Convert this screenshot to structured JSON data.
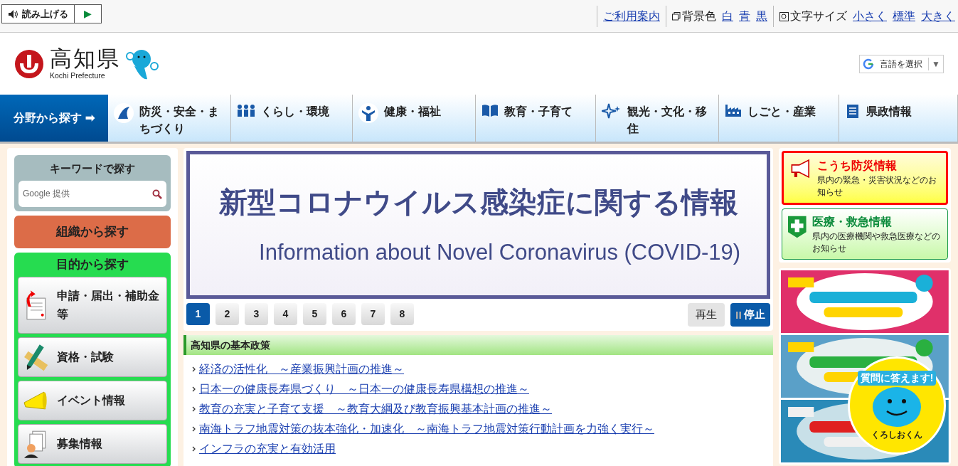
{
  "toolbar": {
    "read_aloud": "読み上げる",
    "play": "▶",
    "links": [
      {
        "kind": "link",
        "label": "ご利用案内"
      },
      {
        "kind": "label",
        "label": "背景色"
      },
      {
        "kind": "link",
        "label": "白"
      },
      {
        "kind": "link",
        "label": "青"
      },
      {
        "kind": "link",
        "label": "黒"
      },
      {
        "kind": "label",
        "label": "文字サイズ"
      },
      {
        "kind": "link",
        "label": "小さく"
      },
      {
        "kind": "link",
        "label": "標準"
      },
      {
        "kind": "link",
        "label": "大きく"
      }
    ]
  },
  "header": {
    "logo_title": "高知県",
    "logo_subtitle": "Kochi Prefecture",
    "language": "言語を選択",
    "language_caret": "▼"
  },
  "nav": {
    "lead": "分野から探す ➡",
    "items": [
      {
        "label": "防災・安全・まちづくり"
      },
      {
        "label": "くらし・環境"
      },
      {
        "label": "健康・福祉"
      },
      {
        "label": "教育・子育て"
      },
      {
        "label": "観光・文化・移住"
      },
      {
        "label": "しごと・産業"
      },
      {
        "label": "県政情報"
      }
    ]
  },
  "sidebar": {
    "keyword_title": "キーワードで探す",
    "search_placeholder": "Google 提供",
    "org_button": "組織から探す",
    "purpose_title": "目的から探す",
    "items": [
      {
        "label": "申請・届出・補助金等"
      },
      {
        "label": "資格・試験"
      },
      {
        "label": "イベント情報"
      },
      {
        "label": "募集情報"
      }
    ]
  },
  "banner": {
    "title": "新型コロナウイルス感染症に関する情報",
    "subtitle": "Information about Novel Coronavirus (COVID-19)"
  },
  "slides": [
    {
      "label": "1",
      "selected": true
    },
    {
      "label": "2",
      "selected": false
    },
    {
      "label": "3",
      "selected": false
    },
    {
      "label": "4",
      "selected": false
    },
    {
      "label": "5",
      "selected": false
    },
    {
      "label": "6",
      "selected": false
    },
    {
      "label": "7",
      "selected": false
    },
    {
      "label": "8",
      "selected": false
    }
  ],
  "slide_controls": {
    "play": "再生",
    "stop": "停止",
    "playing": true
  },
  "policy": {
    "title": "高知県の基本政策",
    "links": [
      "経済の活性化　～産業振興計画の推進～",
      "日本一の健康長寿県づくり　～日本一の健康長寿県構想の推進～",
      "教育の充実と子育て支援　～教育大綱及び教育振興基本計画の推進～",
      "南海トラフ地震対策の抜本強化・加速化　～南海トラフ地震対策行動計画を力強く実行～",
      "インフラの充実と有効活用"
    ]
  },
  "info_boxes": [
    {
      "kind": "disaster",
      "title": "こうち防災情報",
      "text": "県内の緊急・災害状況などのお知らせ"
    },
    {
      "kind": "medical",
      "title": "医療・救急情報",
      "text": "県内の医療機関や救急医療などのお知らせ"
    }
  ],
  "chatbot": {
    "title": "質問に答えます!",
    "name": "くろしおくん"
  }
}
